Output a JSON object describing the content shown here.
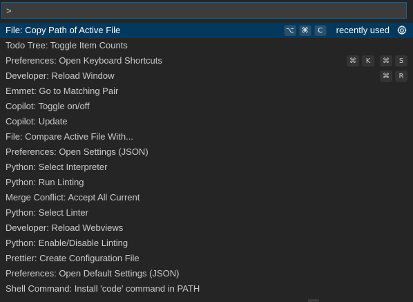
{
  "input": {
    "value": ">"
  },
  "rows": [
    {
      "label": "File: Copy Path of Active File",
      "keys": [
        "⌥",
        "⌘",
        "C"
      ],
      "badge": "recently used",
      "active": true
    },
    {
      "label": "Todo Tree: Toggle Item Counts"
    },
    {
      "label": "Preferences: Open Keyboard Shortcuts",
      "chords": [
        [
          "⌘",
          "K"
        ],
        [
          "⌘",
          "S"
        ]
      ]
    },
    {
      "label": "Developer: Reload Window",
      "chords": [
        [
          "⌘",
          "R"
        ]
      ]
    },
    {
      "label": "Emmet: Go to Matching Pair"
    },
    {
      "label": "Copilot: Toggle on/off"
    },
    {
      "label": "Copilot: Update"
    },
    {
      "label": "File: Compare Active File With..."
    },
    {
      "label": "Preferences: Open Settings (JSON)"
    },
    {
      "label": "Python: Select Interpreter"
    },
    {
      "label": "Python: Run Linting"
    },
    {
      "label": "Merge Conflict: Accept All Current"
    },
    {
      "label": "Python: Select Linter"
    },
    {
      "label": "Developer: Reload Webviews"
    },
    {
      "label": "Python: Enable/Disable Linting"
    },
    {
      "label": "Prettier: Create Configuration File"
    },
    {
      "label": "Preferences: Open Default Settings (JSON)"
    },
    {
      "label": "Shell Command: Install 'code' command in PATH"
    }
  ],
  "icons": {
    "gear": "gear-icon"
  },
  "colors": {
    "background": "#252526",
    "selection": "#04395e",
    "focus_border": "#0e639c",
    "text": "#cccccc"
  }
}
